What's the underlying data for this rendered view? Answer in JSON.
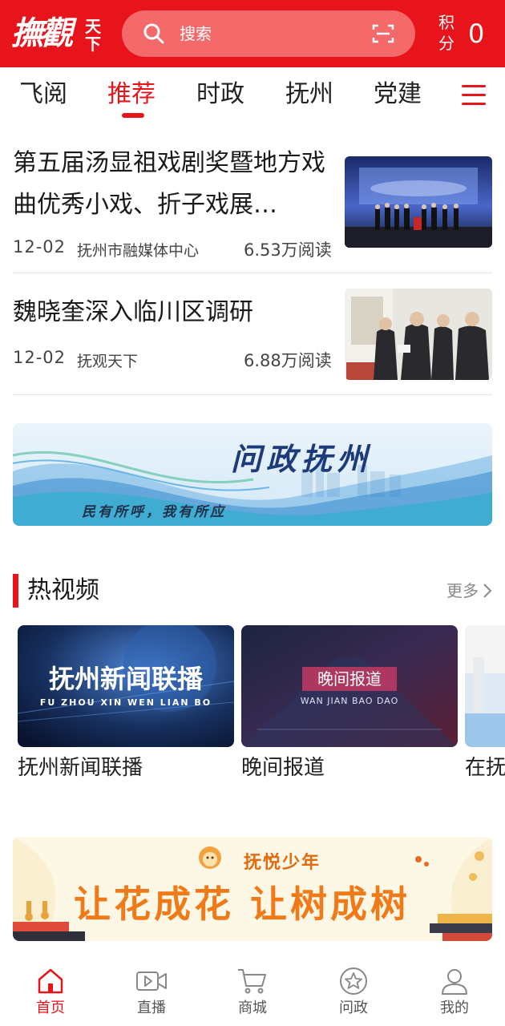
{
  "colors": {
    "brand_red": "#e8141b",
    "search_bg": "#f46a6a",
    "muted": "#8a8a8a"
  },
  "header": {
    "logo_main": "撫觀",
    "logo_small_top": "天",
    "logo_small_bottom": "下",
    "search_placeholder": "搜索",
    "points_label_1": "积",
    "points_label_2": "分",
    "points_value": "0"
  },
  "tabs": [
    "飞阅",
    "推荐",
    "时政",
    "抚州",
    "党建"
  ],
  "active_tab": "推荐",
  "news": [
    {
      "title": "第五届汤显祖戏剧奖暨地方戏曲优秀小戏、折子戏展…",
      "date": "12-02",
      "source": "抚州市融媒体中心",
      "reads": "6.53万阅读"
    },
    {
      "title": "魏晓奎深入临川区调研",
      "date": "12-02",
      "source": "抚观天下",
      "reads": "6.88万阅读"
    }
  ],
  "banner": {
    "title": "问政抚州",
    "subtitle": "民有所呼，我有所应"
  },
  "hot_video": {
    "title": "热视频",
    "more": "更多",
    "items": [
      {
        "label": "抚州新闻联播",
        "thumb_title": "抚州新闻联播",
        "thumb_sub": "FU ZHOU XIN WEN LIAN BO"
      },
      {
        "label": "晚间报道",
        "thumb_title": "晚间报道",
        "thumb_sub": "WAN JIAN BAO DAO"
      },
      {
        "label": "在抚"
      }
    ]
  },
  "promo": {
    "brand": "抚悦少年",
    "slogan": "让花成花 让树成树"
  },
  "bottom_nav": [
    {
      "label": "首页",
      "icon": "home-icon"
    },
    {
      "label": "直播",
      "icon": "live-video-icon"
    },
    {
      "label": "商城",
      "icon": "cart-icon"
    },
    {
      "label": "问政",
      "icon": "star-icon"
    },
    {
      "label": "我的",
      "icon": "user-icon"
    }
  ],
  "active_nav": "首页"
}
